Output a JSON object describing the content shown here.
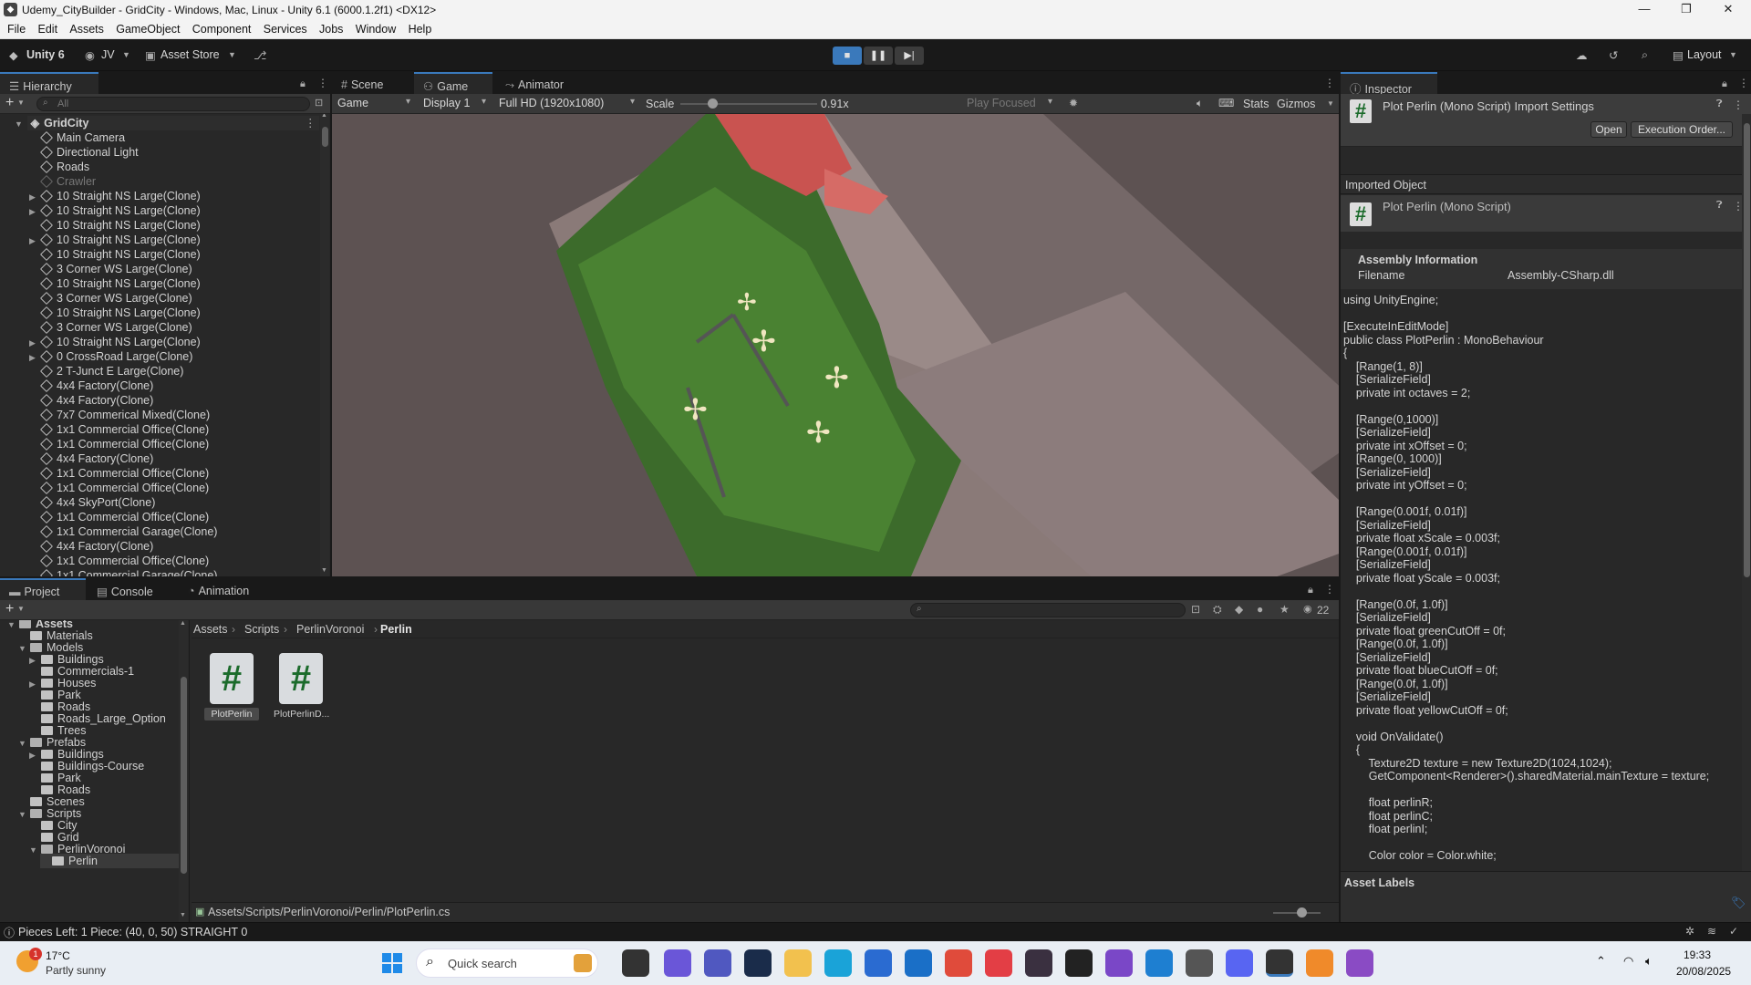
{
  "window": {
    "title": "Udemy_CityBuilder - GridCity - Windows, Mac, Linux - Unity 6.1 (6000.1.2f1) <DX12>"
  },
  "menu": [
    "File",
    "Edit",
    "Assets",
    "GameObject",
    "Component",
    "Services",
    "Jobs",
    "Window",
    "Help"
  ],
  "toolbar": {
    "unity": "Unity 6",
    "account": "JV",
    "asset_store": "Asset Store",
    "layout": "Layout"
  },
  "hierarchy": {
    "tab": "Hierarchy",
    "search_placeholder": "All",
    "scene": "GridCity",
    "items": [
      {
        "label": "Main Camera",
        "arrow": false,
        "dim": false
      },
      {
        "label": "Directional Light",
        "arrow": false,
        "dim": false
      },
      {
        "label": "Roads",
        "arrow": false,
        "dim": false
      },
      {
        "label": "Crawler",
        "arrow": false,
        "dim": true
      },
      {
        "label": "10 Straight NS Large(Clone)",
        "arrow": true,
        "dim": false
      },
      {
        "label": "10 Straight NS Large(Clone)",
        "arrow": true,
        "dim": false
      },
      {
        "label": "10 Straight NS Large(Clone)",
        "arrow": false,
        "dim": false
      },
      {
        "label": "10 Straight NS Large(Clone)",
        "arrow": true,
        "dim": false
      },
      {
        "label": "10 Straight NS Large(Clone)",
        "arrow": false,
        "dim": false
      },
      {
        "label": "3 Corner WS Large(Clone)",
        "arrow": false,
        "dim": false
      },
      {
        "label": "10 Straight NS Large(Clone)",
        "arrow": false,
        "dim": false
      },
      {
        "label": "3 Corner WS Large(Clone)",
        "arrow": false,
        "dim": false
      },
      {
        "label": "10 Straight NS Large(Clone)",
        "arrow": false,
        "dim": false
      },
      {
        "label": "3 Corner WS Large(Clone)",
        "arrow": false,
        "dim": false
      },
      {
        "label": "10 Straight NS Large(Clone)",
        "arrow": true,
        "dim": false
      },
      {
        "label": "0 CrossRoad Large(Clone)",
        "arrow": true,
        "dim": false
      },
      {
        "label": "2 T-Junct E Large(Clone)",
        "arrow": false,
        "dim": false
      },
      {
        "label": "4x4 Factory(Clone)",
        "arrow": false,
        "dim": false
      },
      {
        "label": "4x4 Factory(Clone)",
        "arrow": false,
        "dim": false
      },
      {
        "label": "7x7 Commerical Mixed(Clone)",
        "arrow": false,
        "dim": false
      },
      {
        "label": "1x1 Commercial Office(Clone)",
        "arrow": false,
        "dim": false
      },
      {
        "label": "1x1 Commercial Office(Clone)",
        "arrow": false,
        "dim": false
      },
      {
        "label": "4x4 Factory(Clone)",
        "arrow": false,
        "dim": false
      },
      {
        "label": "1x1 Commercial Office(Clone)",
        "arrow": false,
        "dim": false
      },
      {
        "label": "1x1 Commercial Office(Clone)",
        "arrow": false,
        "dim": false
      },
      {
        "label": "4x4 SkyPort(Clone)",
        "arrow": false,
        "dim": false
      },
      {
        "label": "1x1 Commercial Office(Clone)",
        "arrow": false,
        "dim": false
      },
      {
        "label": "1x1 Commercial Garage(Clone)",
        "arrow": false,
        "dim": false
      },
      {
        "label": "4x4 Factory(Clone)",
        "arrow": false,
        "dim": false
      },
      {
        "label": "1x1 Commercial Office(Clone)",
        "arrow": false,
        "dim": false
      },
      {
        "label": "1x1 Commercial Garage(Clone)",
        "arrow": false,
        "dim": false
      }
    ]
  },
  "game": {
    "tabs": [
      "Scene",
      "Game",
      "Animator"
    ],
    "dropdown_mode": "Game",
    "dropdown_display": "Display 1",
    "dropdown_resolution": "Full HD (1920x1080)",
    "scale_label": "Scale",
    "scale_value": "0.91x",
    "scale_fraction": 0.23,
    "play_focused": "Play Focused",
    "stats": "Stats",
    "gizmos": "Gizmos"
  },
  "inspector": {
    "tab": "Inspector",
    "title": "Plot Perlin (Mono Script) Import Settings",
    "open": "Open",
    "execution_order": "Execution Order...",
    "imported_object": "Imported Object",
    "object_name": "Plot Perlin (Mono Script)",
    "assembly_info": "Assembly Information",
    "filename_label": "Filename",
    "filename_value": "Assembly-CSharp.dll",
    "code": "using UnityEngine;\n\n[ExecuteInEditMode]\npublic class PlotPerlin : MonoBehaviour\n{\n    [Range(1, 8)]\n    [SerializeField]\n    private int octaves = 2;\n\n    [Range(0,1000)]\n    [SerializeField]\n    private int xOffset = 0;\n    [Range(0, 1000)]\n    [SerializeField]\n    private int yOffset = 0;\n\n    [Range(0.001f, 0.01f)]\n    [SerializeField]\n    private float xScale = 0.003f;\n    [Range(0.001f, 0.01f)]\n    [SerializeField]\n    private float yScale = 0.003f;\n\n    [Range(0.0f, 1.0f)]\n    [SerializeField]\n    private float greenCutOff = 0f;\n    [Range(0.0f, 1.0f)]\n    [SerializeField]\n    private float blueCutOff = 0f;\n    [Range(0.0f, 1.0f)]\n    [SerializeField]\n    private float yellowCutOff = 0f;\n\n    void OnValidate()\n    {\n        Texture2D texture = new Texture2D(1024,1024);\n        GetComponent<Renderer>().sharedMaterial.mainTexture = texture;\n\n        float perlinR;\n        float perlinC;\n        float perlinI;\n\n        Color color = Color.white;",
    "asset_labels": "Asset Labels"
  },
  "project": {
    "tabs": [
      "Project",
      "Console",
      "Animation"
    ],
    "count": "22",
    "tree": [
      {
        "label": "Assets",
        "depth": 0,
        "arrow": "open"
      },
      {
        "label": "Materials",
        "depth": 1,
        "arrow": ""
      },
      {
        "label": "Models",
        "depth": 1,
        "arrow": "open"
      },
      {
        "label": "Buildings",
        "depth": 2,
        "arrow": "closed"
      },
      {
        "label": "Commercials-1",
        "depth": 2,
        "arrow": ""
      },
      {
        "label": "Houses",
        "depth": 2,
        "arrow": "closed"
      },
      {
        "label": "Park",
        "depth": 2,
        "arrow": ""
      },
      {
        "label": "Roads",
        "depth": 2,
        "arrow": ""
      },
      {
        "label": "Roads_Large_Option",
        "depth": 2,
        "arrow": ""
      },
      {
        "label": "Trees",
        "depth": 2,
        "arrow": ""
      },
      {
        "label": "Prefabs",
        "depth": 1,
        "arrow": "open"
      },
      {
        "label": "Buildings",
        "depth": 2,
        "arrow": "closed"
      },
      {
        "label": "Buildings-Course",
        "depth": 2,
        "arrow": ""
      },
      {
        "label": "Park",
        "depth": 2,
        "arrow": ""
      },
      {
        "label": "Roads",
        "depth": 2,
        "arrow": ""
      },
      {
        "label": "Scenes",
        "depth": 1,
        "arrow": ""
      },
      {
        "label": "Scripts",
        "depth": 1,
        "arrow": "open"
      },
      {
        "label": "City",
        "depth": 2,
        "arrow": ""
      },
      {
        "label": "Grid",
        "depth": 2,
        "arrow": ""
      },
      {
        "label": "PerlinVoronoi",
        "depth": 2,
        "arrow": "open"
      },
      {
        "label": "Perlin",
        "depth": 3,
        "arrow": ""
      }
    ],
    "breadcrumb": [
      "Assets",
      "Scripts",
      "PerlinVoronoi",
      "Perlin"
    ],
    "files": [
      {
        "label": "PlotPerlin",
        "selected": true
      },
      {
        "label": "PlotPerlinD...",
        "selected": false
      }
    ],
    "path": "Assets/Scripts/PerlinVoronoi/Perlin/PlotPerlin.cs"
  },
  "status": {
    "text": "Pieces Left: 1 Piece: (40, 0, 50) STRAIGHT 0"
  },
  "taskbar": {
    "temp": "17°C",
    "weather": "Partly sunny",
    "badge": "1",
    "search": "Quick search",
    "time": "19:33",
    "date": "20/08/2025"
  },
  "colors": {
    "accent": "#3a79bb",
    "panel": "#282828",
    "game_bg": "#5d5252"
  }
}
